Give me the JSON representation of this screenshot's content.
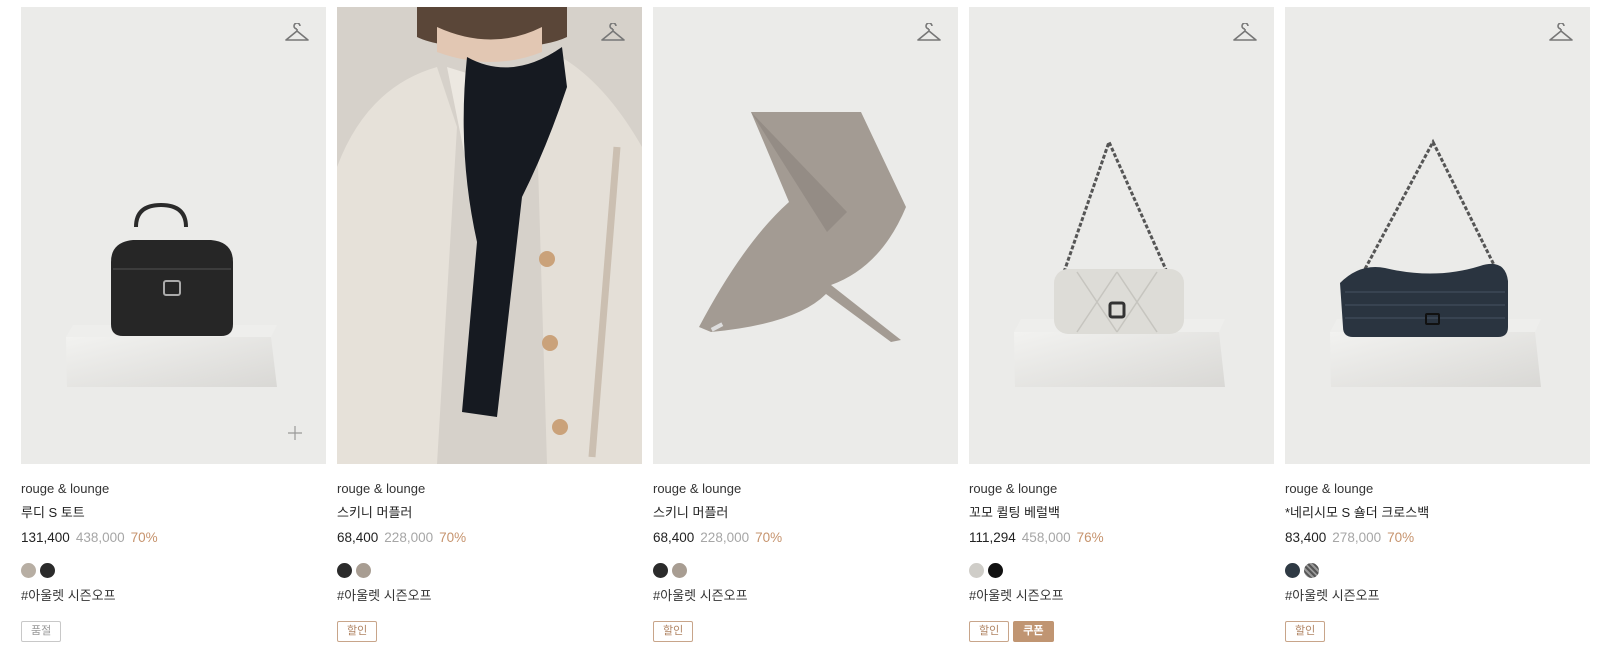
{
  "products": [
    {
      "brand": "rouge & lounge",
      "name": "루디 S 토트",
      "price": "131,400",
      "original_price": "438,000",
      "discount": "70%",
      "swatches": [
        "#b7aea3",
        "#2b2b2b"
      ],
      "hashtag": "#아울렛 시즌오프",
      "badges": [
        {
          "label": "품절",
          "type": "soldout"
        }
      ],
      "image_bg": "#ebebe9",
      "image_kind": "black-tote"
    },
    {
      "brand": "rouge & lounge",
      "name": "스키니 머플러",
      "price": "68,400",
      "original_price": "228,000",
      "discount": "70%",
      "swatches": [
        "#2b2b2b",
        "#a89d92"
      ],
      "hashtag": "#아울렛 시즌오프",
      "badges": [
        {
          "label": "할인",
          "type": "sale"
        }
      ],
      "image_bg": "#d8d3cc",
      "image_kind": "model-scarf"
    },
    {
      "brand": "rouge & lounge",
      "name": "스키니 머플러",
      "price": "68,400",
      "original_price": "228,000",
      "discount": "70%",
      "swatches": [
        "#2b2b2b",
        "#a89d92"
      ],
      "hashtag": "#아울렛 시즌오프",
      "badges": [
        {
          "label": "할인",
          "type": "sale"
        }
      ],
      "image_bg": "#ebebe9",
      "image_kind": "gray-scarf"
    },
    {
      "brand": "rouge & lounge",
      "name": "꼬모 퀼팅 베럴백",
      "price": "111,294",
      "original_price": "458,000",
      "discount": "76%",
      "swatches": [
        "#cfcdc8",
        "#111111"
      ],
      "hashtag": "#아울렛 시즌오프",
      "badges": [
        {
          "label": "할인",
          "type": "sale"
        },
        {
          "label": "쿠폰",
          "type": "coupon"
        }
      ],
      "image_bg": "#ebebe9",
      "image_kind": "white-barrel"
    },
    {
      "brand": "rouge & lounge",
      "name": "*네리시모 S 숄더 크로스백",
      "price": "83,400",
      "original_price": "278,000",
      "discount": "70%",
      "swatches": [
        "#2f3a44",
        "#6b6b6b"
      ],
      "hashtag": "#아울렛 시즌오프",
      "badges": [
        {
          "label": "할인",
          "type": "sale"
        }
      ],
      "image_bg": "#ebebe9",
      "image_kind": "navy-woven"
    }
  ],
  "icons": {
    "wishlist": "hanger-icon",
    "quick_add": "plus-icon"
  },
  "colors": {
    "discount": "#c6936d",
    "original_price": "#a6a6a6",
    "coupon_badge": "#c09572"
  }
}
